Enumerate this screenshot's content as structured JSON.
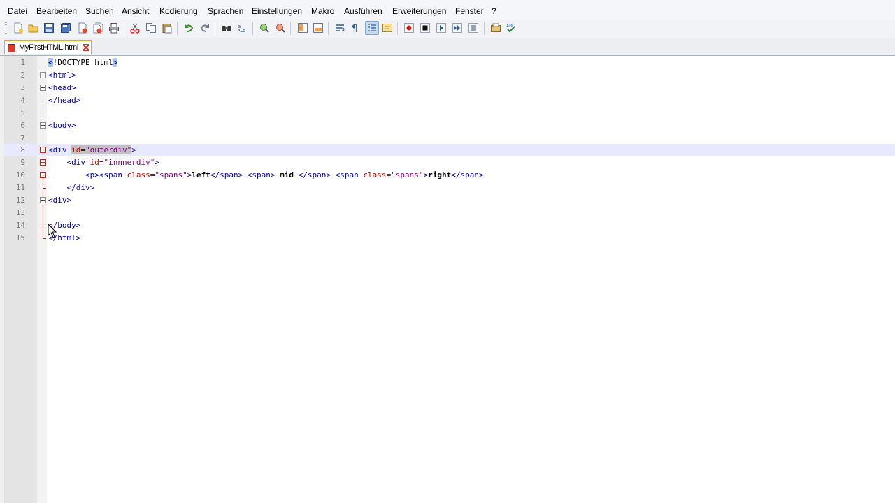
{
  "menu": [
    "Datei",
    "Bearbeiten",
    "Suchen",
    "Ansicht",
    "Kodierung",
    "Sprachen",
    "Einstellungen",
    "Makro",
    "Ausführen",
    "Erweiterungen",
    "Fenster",
    "?"
  ],
  "toolbar": {
    "icons": [
      "new-file-icon",
      "open-file-icon",
      "save-icon",
      "save-all-icon",
      "close-icon",
      "close-all-icon",
      "print-icon",
      "cut-icon",
      "copy-icon",
      "paste-icon",
      "undo-icon",
      "redo-icon",
      "find-icon",
      "replace-icon",
      "zoom-in-icon",
      "zoom-out-icon",
      "sync-vertical-icon",
      "sync-horizontal-icon",
      "word-wrap-icon",
      "show-all-chars-icon",
      "indent-guide-icon",
      "doc-map-icon",
      "record-macro-icon",
      "stop-record-icon",
      "play-macro-icon",
      "run-macro-multiple-icon",
      "save-macro-icon",
      "preview-icon",
      "spellcheck-icon"
    ]
  },
  "tab": {
    "label": "MyFirstHTML.html"
  },
  "colors": {
    "tag": "#0000c0",
    "attribute": "#c80000",
    "string": "#7f007f",
    "current_line": "#e8e8ff",
    "tab_accent": "#f7a02a"
  },
  "editor": {
    "line_numbers": [
      "1",
      "2",
      "3",
      "4",
      "5",
      "6",
      "7",
      "8",
      "9",
      "10",
      "11",
      "12",
      "13",
      "14",
      "15"
    ],
    "lines": [
      {
        "text": "<!DOCTYPE html>"
      },
      {
        "text": "<html>"
      },
      {
        "text": "<head>"
      },
      {
        "text": "</head>"
      },
      {
        "text": ""
      },
      {
        "text": "<body>"
      },
      {
        "text": ""
      },
      {
        "text": "<div id=\"outerdiv\">"
      },
      {
        "text": "    <div id=\"innnerdiv\">"
      },
      {
        "text": "        <p><span class=\"spans\">left</span> <span> mid </span> <span class=\"spans\">right</span>"
      },
      {
        "text": "    </div>"
      },
      {
        "text": "<div>"
      },
      {
        "text": ""
      },
      {
        "text": "</body>"
      },
      {
        "text": "</html>"
      }
    ],
    "current_line": 8
  }
}
